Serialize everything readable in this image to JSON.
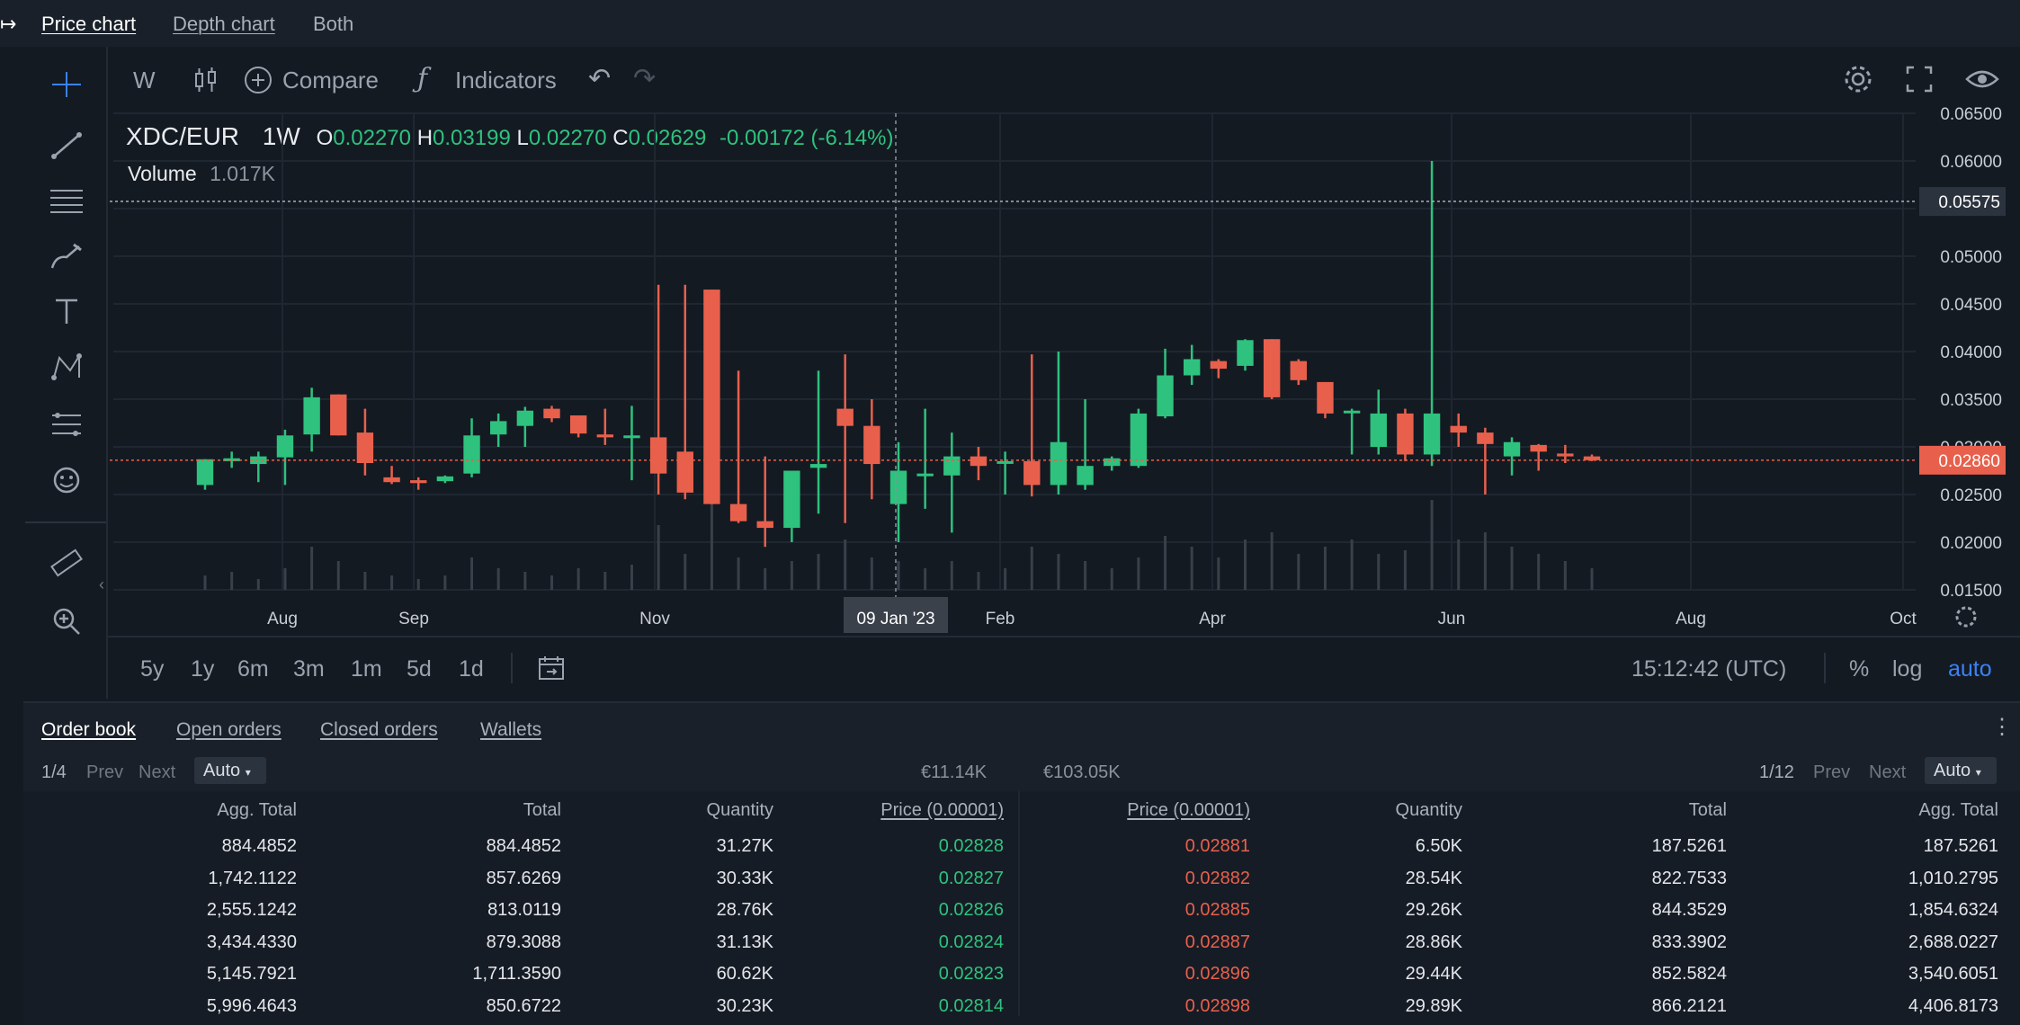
{
  "top_tabs": [
    {
      "label": "Price chart",
      "active": true
    },
    {
      "label": "Depth chart",
      "active": false
    },
    {
      "label": "Both",
      "active": false
    }
  ],
  "left_tools": [
    "crosshair-icon",
    "trend-line-icon",
    "horizontal-lines-icon",
    "brush-icon",
    "text-icon",
    "pattern-icon",
    "measure-lines-icon",
    "emoji-icon",
    "ruler-icon",
    "zoom-in-icon"
  ],
  "toolbar": {
    "interval": "W",
    "compare": "Compare",
    "indicators": "Indicators",
    "icons": [
      "candles-icon",
      "plus-circle-icon",
      "fx-icon",
      "undo-icon",
      "redo-icon",
      "gear-icon",
      "fullscreen-icon",
      "eye-icon"
    ]
  },
  "legend": {
    "symbol": "XDC/EUR",
    "interval": "1W",
    "o_label": "O",
    "o_val": "0.02270",
    "h_label": "H",
    "h_val": "0.03199",
    "l_label": "L",
    "l_val": "0.02270",
    "c_label": "C",
    "c_val": "0.02629",
    "change": "-0.00172 (-6.14%)",
    "volume_label": "Volume",
    "volume_val": "1.017K"
  },
  "price_axis": {
    "ticks": [
      "0.06500",
      "0.06000",
      "0.05500",
      "0.05000",
      "0.04500",
      "0.04000",
      "0.03500",
      "0.03000",
      "0.02500",
      "0.02000",
      "0.01500"
    ],
    "hline_label": "0.05575",
    "current_label": "0.02860"
  },
  "time_axis": {
    "labels": [
      "Aug",
      "Sep",
      "Nov",
      "Feb",
      "Apr",
      "Jun",
      "Aug",
      "Oct"
    ],
    "crosshair_label": "09 Jan '23"
  },
  "periods": [
    "5y",
    "1y",
    "6m",
    "3m",
    "1m",
    "5d",
    "1d"
  ],
  "clock": "15:12:42 (UTC)",
  "scale_options": [
    "%",
    "log",
    "auto"
  ],
  "chart_data": {
    "type": "candlestick",
    "symbol": "XDC/EUR",
    "interval": "1W",
    "ylim": [
      0.015,
      0.065
    ],
    "candles": [
      {
        "o": 0.026,
        "h": 0.0287,
        "l": 0.0255,
        "c": 0.0287
      },
      {
        "o": 0.0285,
        "h": 0.0295,
        "l": 0.0278,
        "c": 0.0288
      },
      {
        "o": 0.0282,
        "h": 0.0295,
        "l": 0.0263,
        "c": 0.029
      },
      {
        "o": 0.0289,
        "h": 0.0318,
        "l": 0.026,
        "c": 0.0312
      },
      {
        "o": 0.0313,
        "h": 0.0362,
        "l": 0.0295,
        "c": 0.0352
      },
      {
        "o": 0.0355,
        "h": 0.0355,
        "l": 0.0312,
        "c": 0.0312
      },
      {
        "o": 0.0315,
        "h": 0.034,
        "l": 0.027,
        "c": 0.0283
      },
      {
        "o": 0.0268,
        "h": 0.028,
        "l": 0.0261,
        "c": 0.0263
      },
      {
        "o": 0.0265,
        "h": 0.0268,
        "l": 0.0255,
        "c": 0.0262
      },
      {
        "o": 0.0264,
        "h": 0.027,
        "l": 0.0262,
        "c": 0.0269
      },
      {
        "o": 0.0272,
        "h": 0.033,
        "l": 0.0268,
        "c": 0.0312
      },
      {
        "o": 0.0313,
        "h": 0.0335,
        "l": 0.03,
        "c": 0.0327
      },
      {
        "o": 0.0322,
        "h": 0.0342,
        "l": 0.03,
        "c": 0.0338
      },
      {
        "o": 0.034,
        "h": 0.0343,
        "l": 0.0326,
        "c": 0.033
      },
      {
        "o": 0.0333,
        "h": 0.0333,
        "l": 0.031,
        "c": 0.0314
      },
      {
        "o": 0.0313,
        "h": 0.034,
        "l": 0.0302,
        "c": 0.031
      },
      {
        "o": 0.0312,
        "h": 0.0343,
        "l": 0.0265,
        "c": 0.0312
      },
      {
        "o": 0.031,
        "h": 0.047,
        "l": 0.025,
        "c": 0.0272
      },
      {
        "o": 0.0295,
        "h": 0.047,
        "l": 0.0245,
        "c": 0.0252
      },
      {
        "o": 0.0465,
        "h": 0.0465,
        "l": 0.024,
        "c": 0.024
      },
      {
        "o": 0.024,
        "h": 0.038,
        "l": 0.022,
        "c": 0.0222
      },
      {
        "o": 0.0222,
        "h": 0.029,
        "l": 0.0195,
        "c": 0.0215
      },
      {
        "o": 0.0215,
        "h": 0.0275,
        "l": 0.02,
        "c": 0.0275
      },
      {
        "o": 0.0278,
        "h": 0.038,
        "l": 0.023,
        "c": 0.0282
      },
      {
        "o": 0.034,
        "h": 0.0397,
        "l": 0.022,
        "c": 0.0322
      },
      {
        "o": 0.0322,
        "h": 0.035,
        "l": 0.0245,
        "c": 0.0282
      },
      {
        "o": 0.024,
        "h": 0.0305,
        "l": 0.02,
        "c": 0.0275
      },
      {
        "o": 0.0272,
        "h": 0.034,
        "l": 0.0235,
        "c": 0.0272
      },
      {
        "o": 0.027,
        "h": 0.0315,
        "l": 0.021,
        "c": 0.029
      },
      {
        "o": 0.029,
        "h": 0.03,
        "l": 0.0265,
        "c": 0.028
      },
      {
        "o": 0.0285,
        "h": 0.0295,
        "l": 0.025,
        "c": 0.0285
      },
      {
        "o": 0.0285,
        "h": 0.0397,
        "l": 0.0248,
        "c": 0.026
      },
      {
        "o": 0.026,
        "h": 0.04,
        "l": 0.025,
        "c": 0.0305
      },
      {
        "o": 0.026,
        "h": 0.035,
        "l": 0.0255,
        "c": 0.028
      },
      {
        "o": 0.028,
        "h": 0.029,
        "l": 0.0275,
        "c": 0.0288
      },
      {
        "o": 0.028,
        "h": 0.034,
        "l": 0.0278,
        "c": 0.0335
      },
      {
        "o": 0.0332,
        "h": 0.0403,
        "l": 0.033,
        "c": 0.0375
      },
      {
        "o": 0.0375,
        "h": 0.0407,
        "l": 0.0365,
        "c": 0.0392
      },
      {
        "o": 0.039,
        "h": 0.0392,
        "l": 0.0372,
        "c": 0.0382
      },
      {
        "o": 0.0385,
        "h": 0.0413,
        "l": 0.038,
        "c": 0.0412
      },
      {
        "o": 0.0413,
        "h": 0.0413,
        "l": 0.035,
        "c": 0.0352
      },
      {
        "o": 0.039,
        "h": 0.0392,
        "l": 0.0365,
        "c": 0.037
      },
      {
        "o": 0.0368,
        "h": 0.0368,
        "l": 0.033,
        "c": 0.0335
      },
      {
        "o": 0.0338,
        "h": 0.034,
        "l": 0.0292,
        "c": 0.0338
      },
      {
        "o": 0.03,
        "h": 0.036,
        "l": 0.0292,
        "c": 0.0335
      },
      {
        "o": 0.0335,
        "h": 0.034,
        "l": 0.0285,
        "c": 0.0292
      },
      {
        "o": 0.0292,
        "h": 0.06,
        "l": 0.028,
        "c": 0.0335
      },
      {
        "o": 0.0322,
        "h": 0.0335,
        "l": 0.03,
        "c": 0.0315
      },
      {
        "o": 0.0315,
        "h": 0.032,
        "l": 0.025,
        "c": 0.0303
      },
      {
        "o": 0.029,
        "h": 0.031,
        "l": 0.027,
        "c": 0.0305
      },
      {
        "o": 0.0302,
        "h": 0.0303,
        "l": 0.0275,
        "c": 0.0295
      },
      {
        "o": 0.0293,
        "h": 0.0302,
        "l": 0.0283,
        "c": 0.029
      },
      {
        "o": 0.029,
        "h": 0.0292,
        "l": 0.0285,
        "c": 0.0286
      }
    ],
    "volume": [
      4,
      5,
      3,
      6,
      12,
      8,
      5,
      4,
      3,
      4,
      9,
      6,
      5,
      4,
      6,
      5,
      7,
      18,
      10,
      25,
      9,
      6,
      8,
      10,
      14,
      9,
      8,
      6,
      8,
      5,
      6,
      12,
      10,
      8,
      6,
      9,
      15,
      12,
      9,
      14,
      16,
      10,
      12,
      14,
      10,
      11,
      25,
      14,
      16,
      12,
      10,
      8,
      6
    ]
  },
  "orderbook": {
    "tabs": [
      {
        "label": "Order book",
        "active": true
      },
      {
        "label": "Open orders",
        "active": false
      },
      {
        "label": "Closed orders",
        "active": false
      },
      {
        "label": "Wallets",
        "active": false
      }
    ],
    "left_pager": {
      "page": "1/4",
      "prev": "Prev",
      "next": "Next",
      "select": "Auto"
    },
    "right_pager": {
      "page": "1/12",
      "prev": "Prev",
      "next": "Next",
      "select": "Auto"
    },
    "bid_total": "€11.14K",
    "ask_total": "€103.05K",
    "bid_headers": [
      "Agg. Total",
      "Total",
      "Quantity",
      "Price (0.00001)"
    ],
    "ask_headers": [
      "Price (0.00001)",
      "Quantity",
      "Total",
      "Agg. Total"
    ],
    "bids": [
      [
        "884.4852",
        "884.4852",
        "31.27K",
        "0.02828"
      ],
      [
        "1,742.1122",
        "857.6269",
        "30.33K",
        "0.02827"
      ],
      [
        "2,555.1242",
        "813.0119",
        "28.76K",
        "0.02826"
      ],
      [
        "3,434.4330",
        "879.3088",
        "31.13K",
        "0.02824"
      ],
      [
        "5,145.7921",
        "1,711.3590",
        "60.62K",
        "0.02823"
      ],
      [
        "5,996.4643",
        "850.6722",
        "30.23K",
        "0.02814"
      ]
    ],
    "asks": [
      [
        "0.02881",
        "6.50K",
        "187.5261",
        "187.5261"
      ],
      [
        "0.02882",
        "28.54K",
        "822.7533",
        "1,010.2795"
      ],
      [
        "0.02885",
        "29.26K",
        "844.3529",
        "1,854.6324"
      ],
      [
        "0.02887",
        "28.86K",
        "833.3902",
        "2,688.0227"
      ],
      [
        "0.02896",
        "29.44K",
        "852.5824",
        "3,540.6051"
      ],
      [
        "0.02898",
        "29.89K",
        "866.2121",
        "4,406.8173"
      ]
    ]
  },
  "colors": {
    "up": "#2ec27e",
    "down": "#e8604c",
    "bg": "#141a22",
    "accent": "#3b82f6"
  }
}
